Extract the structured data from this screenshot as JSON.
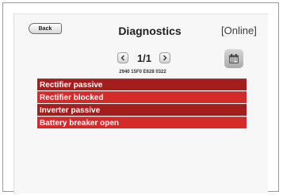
{
  "header": {
    "back_label": "Back",
    "title": "Diagnostics",
    "status": "[Online]"
  },
  "pager": {
    "page": "1/1",
    "code": "2940 15F0 E628 0322"
  },
  "alarms": [
    {
      "label": "Rectifier passive"
    },
    {
      "label": "Rectifier blocked"
    },
    {
      "label": "Inverter passive"
    },
    {
      "label": "Battery breaker open"
    }
  ],
  "icons": {
    "prev": "chevron-left-icon",
    "next": "chevron-right-icon",
    "calendar": "calendar-icon"
  },
  "colors": {
    "alarm_bright": "#d52a2a",
    "alarm_dark": "#a51e1e"
  }
}
